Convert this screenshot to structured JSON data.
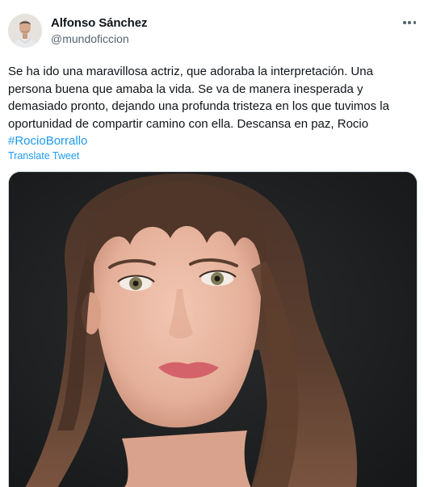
{
  "author": {
    "name": "Alfonso Sánchez",
    "handle": "@mundoficcion"
  },
  "tweet": {
    "lines": [
      "Se ha ido una maravillosa actriz, que adoraba la interpretación. Una",
      "persona buena que amaba la vida. Se va de manera inesperada y",
      "demasiado pronto, dejando una profunda tristeza en los que tuvimos la",
      "oportunidad de compartir camino con ella. Descansa en paz, Rocio"
    ],
    "hashtag": "#RocioBorrallo",
    "translate_label": "Translate Tweet"
  },
  "icons": {
    "more": "more-options-icon"
  },
  "colors": {
    "link": "#1d9bf0",
    "secondary_text": "#536471",
    "primary_text": "#0f1419"
  }
}
